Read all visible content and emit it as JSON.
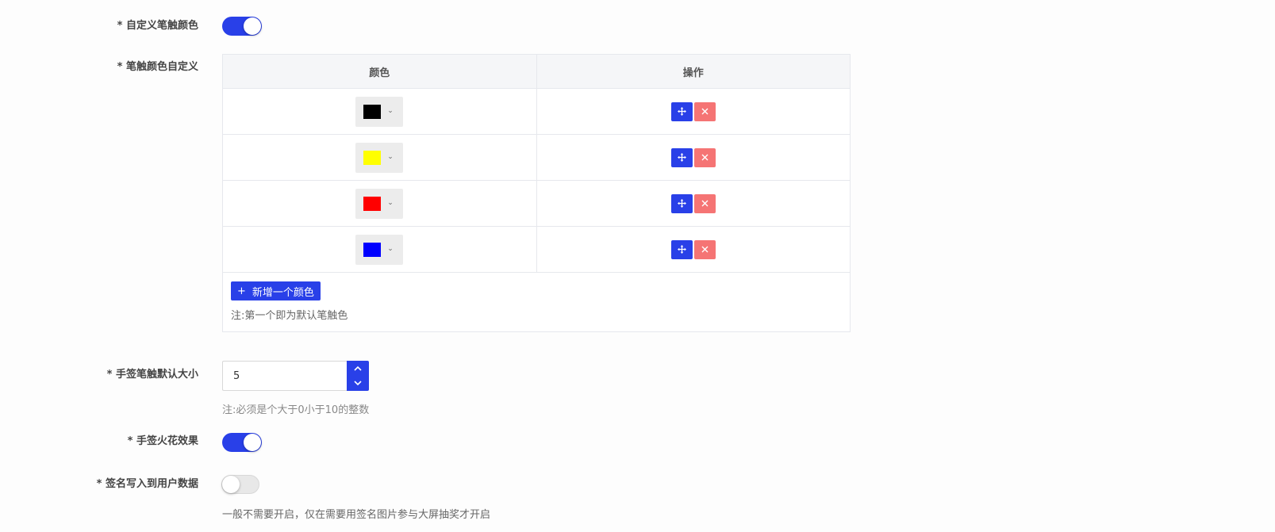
{
  "fields": {
    "custom_color": {
      "label": "* 自定义笔触颜色",
      "enabled": true
    },
    "color_custom": {
      "label": "* 笔触颜色自定义"
    },
    "brush_size": {
      "label": "* 手签笔触默认大小",
      "value": "5",
      "note": "注:必须是个大于0小于10的整数"
    },
    "spark_effect": {
      "label": "* 手签火花效果",
      "enabled": true
    },
    "write_user_data": {
      "label": "* 签名写入到用户数据",
      "enabled": false,
      "note": "一般不需要开启，仅在需要用签名图片参与大屏抽奖才开启"
    }
  },
  "color_table": {
    "headers": [
      "颜色",
      "操作"
    ],
    "rows": [
      {
        "color": "#000000"
      },
      {
        "color": "#ffff00"
      },
      {
        "color": "#ff0000"
      },
      {
        "color": "#0000ff"
      }
    ],
    "add_label": "新增一个颜色",
    "footer_note": "注:第一个即为默认笔触色"
  },
  "icons": {
    "move": "move-icon",
    "delete": "close-icon",
    "add": "plus-icon",
    "caret": "chevron-down-icon",
    "step_up": "chevron-up-icon",
    "step_down": "chevron-down-icon"
  },
  "colors": {
    "accent": "#2940e8",
    "danger": "#f57474"
  }
}
